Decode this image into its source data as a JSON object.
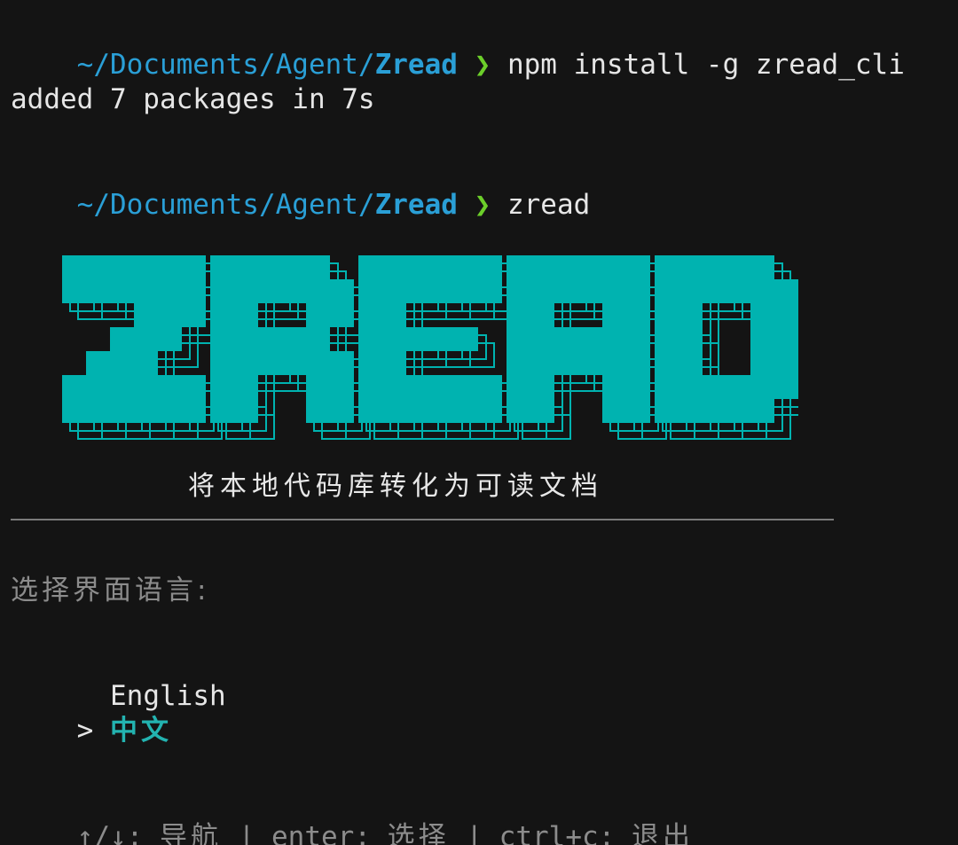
{
  "terminal": {
    "lines": [
      {
        "path_prefix": "~/Documents/Agent/",
        "path_dir": "Zread",
        "prompt": "❯",
        "command": "npm install -g zread_cli"
      },
      {
        "output": "added 7 packages in 7s"
      },
      {
        "path_prefix": "~/Documents/Agent/",
        "path_dir": "Zread",
        "prompt": "❯",
        "command": "zread"
      }
    ]
  },
  "banner": {
    "logo_text": "ZREAD",
    "color": "#00b3b0",
    "tagline": "将本地代码库转化为可读文档"
  },
  "language_menu": {
    "question": "选择界面语言:",
    "options": [
      {
        "label": "English",
        "selected": false
      },
      {
        "label": "中文",
        "selected": true
      }
    ],
    "cursor": ">",
    "selected_color": "#23b3b0"
  },
  "help_bar": {
    "nav_keys": "↑/↓:",
    "nav_label": "导航",
    "sep1": "|",
    "enter_key": "enter:",
    "enter_label": "选择",
    "sep2": "|",
    "exit_key": "ctrl+c:",
    "exit_label": "退出"
  }
}
